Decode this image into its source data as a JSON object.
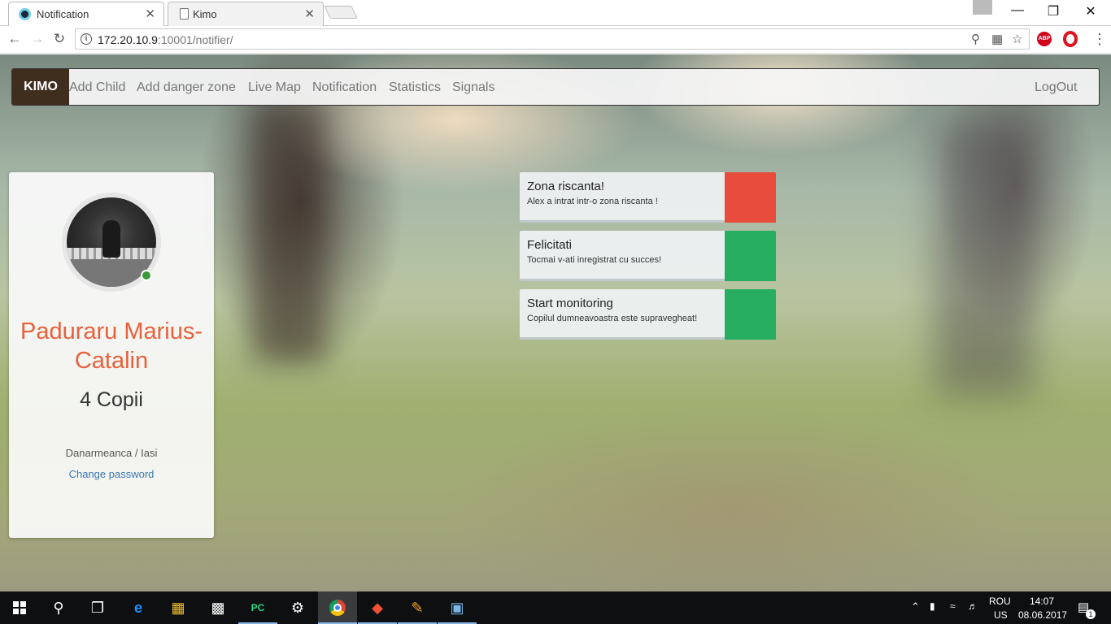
{
  "browser": {
    "tabs": [
      {
        "title": "Notification",
        "icon": "kimo-eye-icon",
        "active": true
      },
      {
        "title": "Kimo",
        "icon": "page-icon",
        "active": false
      }
    ],
    "close_glyph": "✕",
    "url_host": "172.20.10.9",
    "url_rest": ":10001/notifier/",
    "extensions": [
      "ABP",
      "opera-icon"
    ],
    "abp_label": "ABP"
  },
  "navbar": {
    "brand": "KIMO",
    "links": [
      "Add Child",
      "Add danger zone",
      "Live Map",
      "Notification",
      "Statistics",
      "Signals"
    ],
    "logout": "LogOut"
  },
  "profile": {
    "name": "Paduraru Marius-Catalin",
    "kids": "4 Copii",
    "location": "Danarmeanca / Iasi",
    "change_password": "Change password",
    "online_color": "#3a9a3a"
  },
  "notifications": [
    {
      "title": "Zona riscanta!",
      "text": "Alex a intrat intr-o zona riscanta !",
      "color": "#e74c3c"
    },
    {
      "title": "Felicitati",
      "text": "Tocmai v-ati inregistrat cu succes!",
      "color": "#27ae60"
    },
    {
      "title": "Start monitoring",
      "text": "Copilul dumneavoastra este supravegheat!",
      "color": "#27ae60"
    }
  ],
  "taskbar": {
    "lang": "ROU",
    "layout": "US",
    "time": "14:07",
    "date": "08.06.2017",
    "notification_count": "1"
  }
}
